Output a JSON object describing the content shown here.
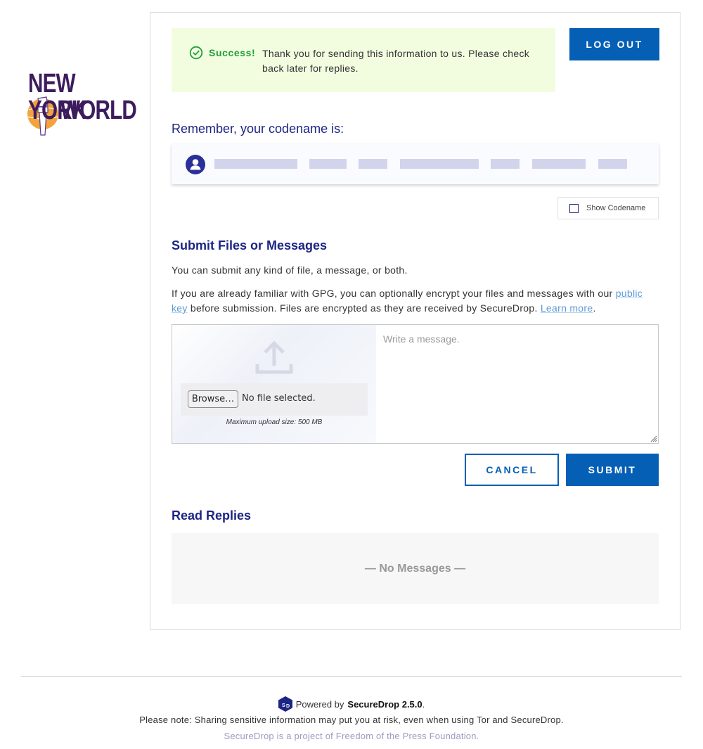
{
  "branding": {
    "logo_line1": "NEW YORK",
    "logo_line2": "WORLD",
    "logo_alt": "New York World logo"
  },
  "flash": {
    "icon": "check-circle-icon",
    "title": "Success!",
    "message": "Thank you for sending this information to us. Please check back later for replies.",
    "color": "#1fa03a",
    "background": "#f2fde0"
  },
  "header": {
    "logout_label": "Log Out"
  },
  "codename": {
    "label": "Remember, your codename is:",
    "avatar_icon": "user-avatar-icon",
    "hidden": true,
    "word_count": 7,
    "show_codename_label": "Show Codename",
    "show_codename_checked": false
  },
  "submit_section": {
    "heading": "Submit Files or Messages",
    "intro": "You can submit any kind of file, a message, or both.",
    "gpg_text_before": "If you are already familiar with GPG, you can optionally encrypt your files and messages with our ",
    "public_key_link": "public key",
    "gpg_text_middle": " before submission. Files are encrypted as they are received by SecureDrop. ",
    "learn_more_link": "Learn more",
    "gpg_text_end": ".",
    "upload_icon": "upload-icon",
    "browse_label": "Browse…",
    "file_status": "No file selected.",
    "max_upload": "Maximum upload size: 500 MB",
    "message_placeholder": "Write a message.",
    "message_value": "",
    "cancel_label": "Cancel",
    "submit_label": "Submit"
  },
  "replies": {
    "heading": "Read Replies",
    "empty_text": "— No Messages —"
  },
  "footer": {
    "powered_by": "Powered by",
    "product": "SecureDrop 2.5.0",
    "period": ".",
    "warning": "Please note: Sharing sensitive information may put you at risk, even when using Tor and SecureDrop.",
    "project_note": "SecureDrop is a project of Freedom of the Press Foundation."
  },
  "colors": {
    "primary": "#055fb5",
    "heading": "#1c2584",
    "link": "#5b9ad6"
  }
}
